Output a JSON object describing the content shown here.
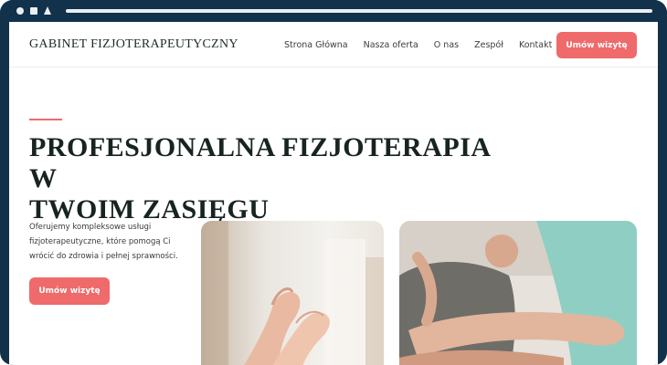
{
  "brand": {
    "name": "GABINET FIZJOTERAPEUTYCZNY"
  },
  "nav": {
    "links": [
      {
        "label": "Strona Główna"
      },
      {
        "label": "Nasza oferta"
      },
      {
        "label": "O nas"
      },
      {
        "label": "Zespół"
      },
      {
        "label": "Kontakt"
      }
    ],
    "cta_label": "Umów wizytę"
  },
  "hero": {
    "title_line1": "PROFESJONALNA FIZJOTERAPIA W",
    "title_line2": "TWOIM ZASIĘGU",
    "description": "Oferujemy kompleksowe usługi fizjoterapeutyczne, które pomogą Ci wrócić do zdrowia i pełnej sprawności.",
    "cta_label": "Umów wizytę"
  },
  "colors": {
    "accent": "#ef6a6a",
    "frame": "#12314a",
    "heading": "#17241f"
  }
}
